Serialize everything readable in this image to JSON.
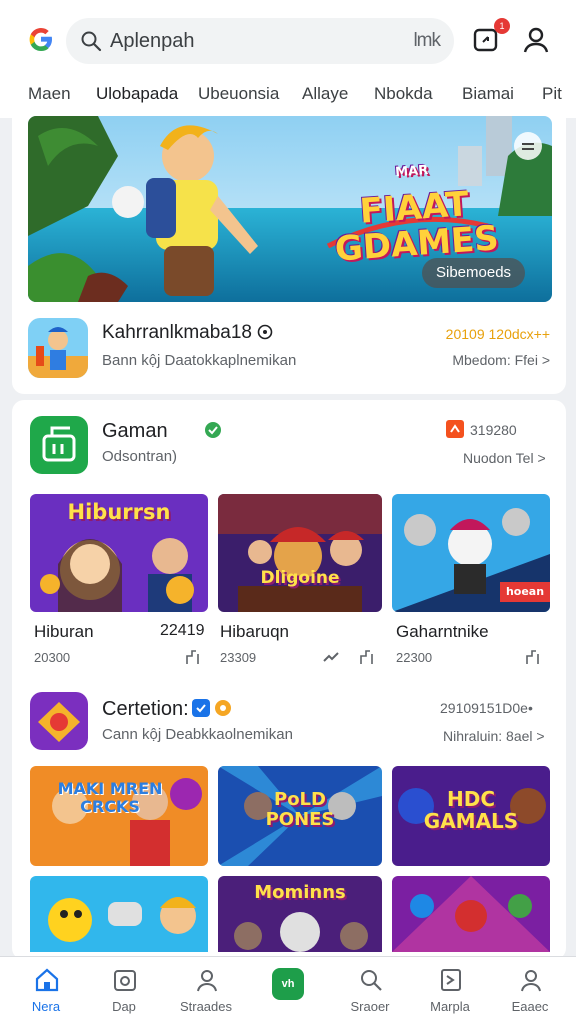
{
  "header": {
    "search_text": "Aplenpah",
    "mic_text": "lmk",
    "notif_count": "1"
  },
  "tabs": [
    {
      "label": "Maen"
    },
    {
      "label": "Ulobapada"
    },
    {
      "label": "Ubeuonsia"
    },
    {
      "label": "Allaye"
    },
    {
      "label": "Nbokda"
    },
    {
      "label": "Biamai"
    },
    {
      "label": "Pit"
    }
  ],
  "banner": {
    "title_small": "MAR",
    "title_line1": "FIAAT",
    "title_line2": "GDAMES",
    "cta": "Sibemoeds"
  },
  "featured": {
    "title": "Kahrranlkmaba18",
    "subtitle": "Bann kộj Daatokkaplnemikan",
    "score": "20109 120dcx++",
    "more": "Mbedom: Ffei >"
  },
  "section1": {
    "title": "Gaman",
    "subtitle": "Odsontran)",
    "score": "319280",
    "more": "Nuodon Tel >",
    "games": [
      {
        "thumb_text": "Hiburrsn",
        "name": "Hiburan",
        "rank": "22419",
        "meta": "20300"
      },
      {
        "thumb_text": "Dligoine",
        "name": "Hibaruqn",
        "rank": "",
        "meta": "23309"
      },
      {
        "thumb_text": "hoean",
        "name": "Gaharntnike",
        "rank": "",
        "meta": "22300"
      }
    ]
  },
  "section2": {
    "title": "Certetion:",
    "subtitle": "Cann kộj Deabkkaolnemikan",
    "score": "29109151D0e•",
    "more": "Nihraluin: 8ael >",
    "games": [
      {
        "thumb_text": "MAKI MREN CRCKS"
      },
      {
        "thumb_text": "PoLD PONES"
      },
      {
        "thumb_text": "HDC GAMALS"
      },
      {
        "thumb_text": ""
      },
      {
        "thumb_text": "Mominns"
      },
      {
        "thumb_text": ""
      }
    ]
  },
  "bottom_nav": [
    {
      "label": "Nera"
    },
    {
      "label": "Dap"
    },
    {
      "label": "Straades"
    },
    {
      "label": "vh"
    },
    {
      "label": "Sraoer"
    },
    {
      "label": "Marpla"
    },
    {
      "label": "Eaaec"
    }
  ],
  "colors": {
    "accent": "#1a73e8",
    "green": "#1e9e4a",
    "score_orange": "#e8a10c"
  }
}
